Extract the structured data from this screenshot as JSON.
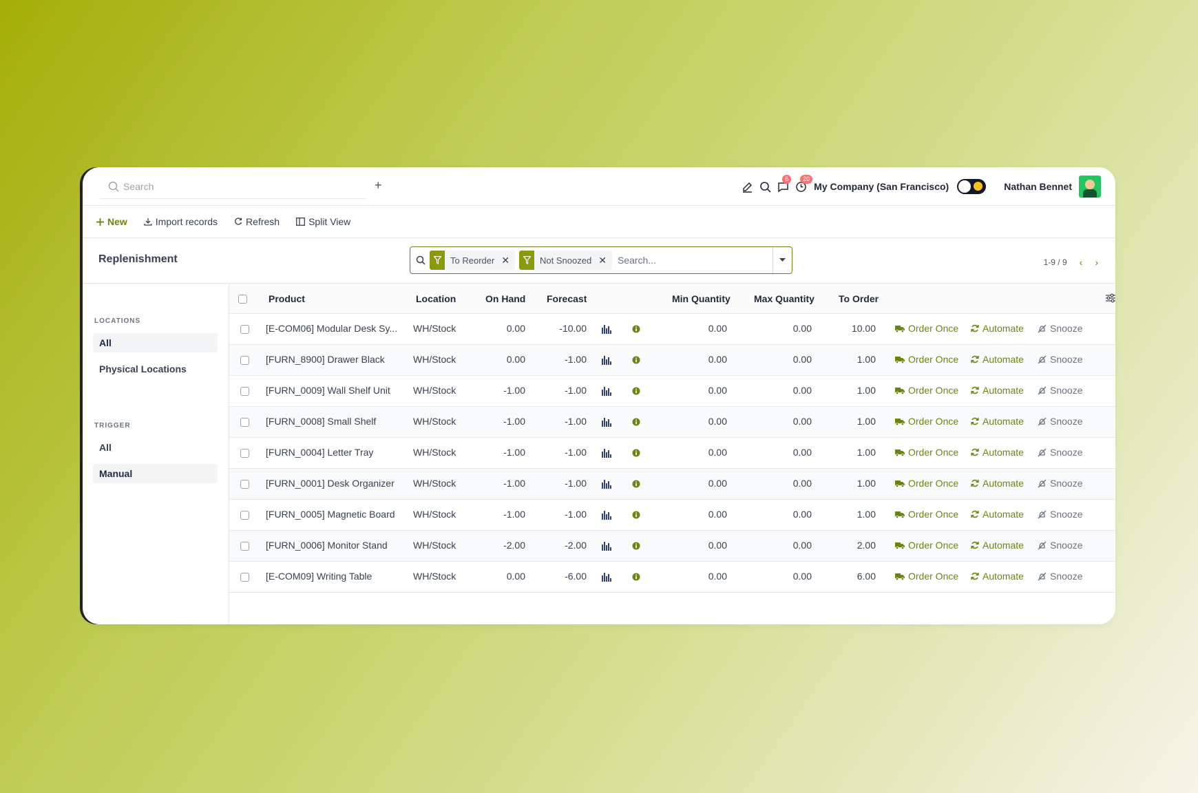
{
  "topbar": {
    "search_placeholder": "Search",
    "add_tab": "+",
    "messages_badge": "6",
    "activities_badge": "20",
    "company": "My Company (San Francisco)",
    "user_name": "Nathan Bennet"
  },
  "actions": {
    "new": "New",
    "import": "Import records",
    "refresh": "Refresh",
    "split_view": "Split View"
  },
  "control": {
    "breadcrumb": "Replenishment",
    "facets": [
      "To Reorder",
      "Not Snoozed"
    ],
    "search_placeholder": "Search...",
    "pager": "1-9 / 9"
  },
  "sidebar": {
    "locations_title": "LOCATIONS",
    "locations": [
      "All",
      "Physical Locations"
    ],
    "trigger_title": "TRIGGER",
    "triggers": [
      "All",
      "Manual"
    ]
  },
  "table": {
    "headers": {
      "product": "Product",
      "location": "Location",
      "on_hand": "On Hand",
      "forecast": "Forecast",
      "min_qty": "Min Quantity",
      "max_qty": "Max Quantity",
      "to_order": "To Order"
    },
    "buttons": {
      "order_once": "Order Once",
      "automate": "Automate",
      "snooze": "Snooze"
    },
    "rows": [
      {
        "product": "[E-COM06] Modular Desk Sy...",
        "location": "WH/Stock",
        "on_hand": "0.00",
        "forecast": "-10.00",
        "min": "0.00",
        "max": "0.00",
        "to_order": "10.00"
      },
      {
        "product": "[FURN_8900] Drawer Black",
        "location": "WH/Stock",
        "on_hand": "0.00",
        "forecast": "-1.00",
        "min": "0.00",
        "max": "0.00",
        "to_order": "1.00"
      },
      {
        "product": "[FURN_0009] Wall Shelf Unit",
        "location": "WH/Stock",
        "on_hand": "-1.00",
        "forecast": "-1.00",
        "min": "0.00",
        "max": "0.00",
        "to_order": "1.00"
      },
      {
        "product": "[FURN_0008] Small Shelf",
        "location": "WH/Stock",
        "on_hand": "-1.00",
        "forecast": "-1.00",
        "min": "0.00",
        "max": "0.00",
        "to_order": "1.00"
      },
      {
        "product": "[FURN_0004] Letter Tray",
        "location": "WH/Stock",
        "on_hand": "-1.00",
        "forecast": "-1.00",
        "min": "0.00",
        "max": "0.00",
        "to_order": "1.00"
      },
      {
        "product": "[FURN_0001] Desk Organizer",
        "location": "WH/Stock",
        "on_hand": "-1.00",
        "forecast": "-1.00",
        "min": "0.00",
        "max": "0.00",
        "to_order": "1.00"
      },
      {
        "product": "[FURN_0005] Magnetic Board",
        "location": "WH/Stock",
        "on_hand": "-1.00",
        "forecast": "-1.00",
        "min": "0.00",
        "max": "0.00",
        "to_order": "1.00"
      },
      {
        "product": "[FURN_0006] Monitor Stand",
        "location": "WH/Stock",
        "on_hand": "-2.00",
        "forecast": "-2.00",
        "min": "0.00",
        "max": "0.00",
        "to_order": "2.00"
      },
      {
        "product": "[E-COM09] Writing Table",
        "location": "WH/Stock",
        "on_hand": "0.00",
        "forecast": "-6.00",
        "min": "0.00",
        "max": "0.00",
        "to_order": "6.00"
      }
    ]
  },
  "colors": {
    "accent": "#6b8512",
    "facet_icon": "#8a9a0b",
    "badge": "#f87171"
  }
}
